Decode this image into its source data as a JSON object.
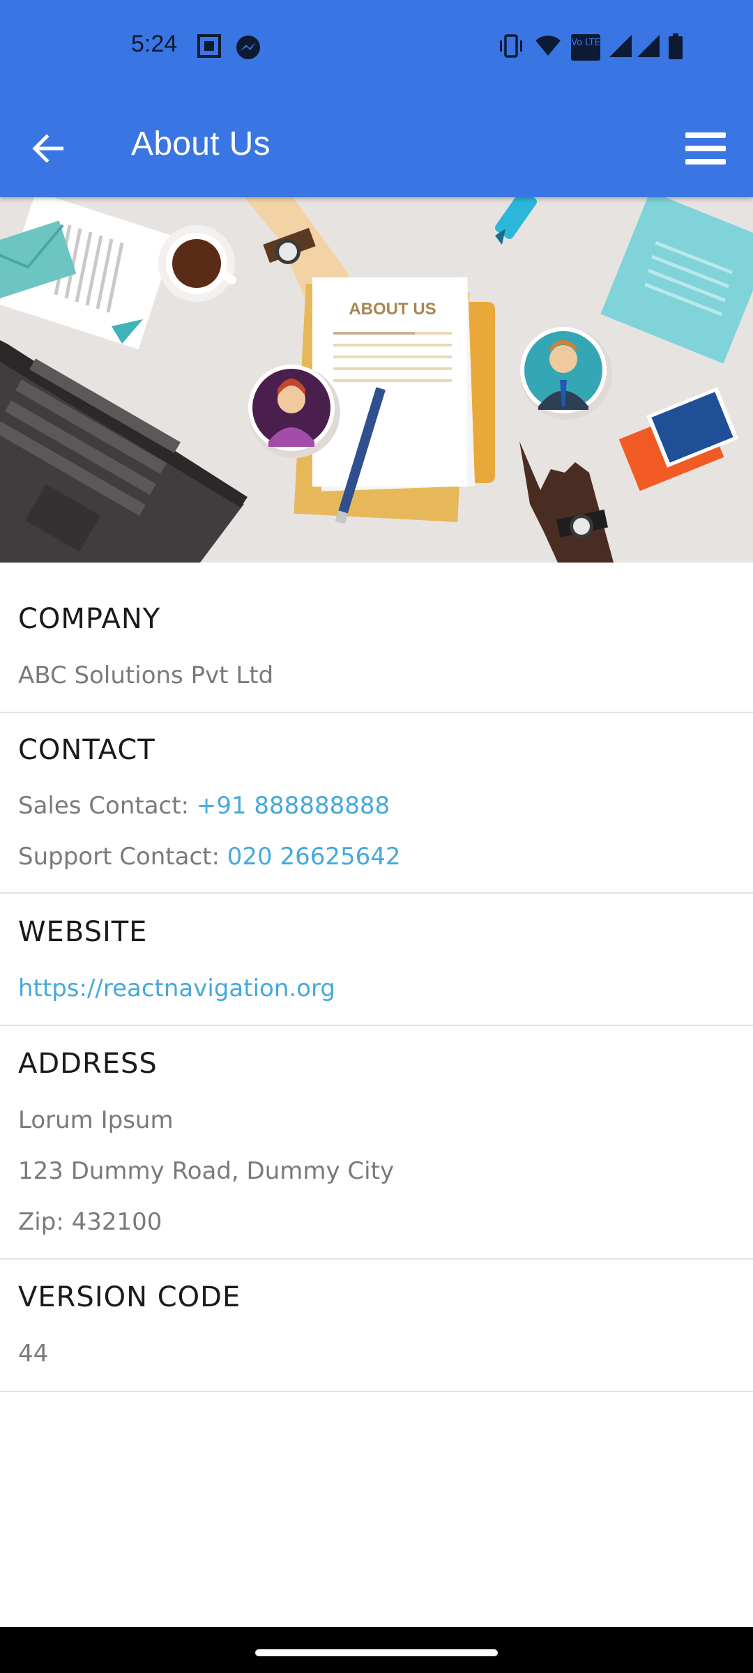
{
  "status_bar": {
    "time": "5:24",
    "volte_label": "Vo LTE",
    "icons": [
      "screenshot-icon",
      "messenger-icon",
      "vibrate-icon",
      "wifi-icon",
      "volte-icon",
      "signal-icon",
      "signal-icon",
      "battery-icon"
    ]
  },
  "app_bar": {
    "title": "About Us",
    "back_icon": "arrow-left-icon",
    "menu_icon": "hamburger-menu-icon",
    "accent_color": "#3a76e3"
  },
  "hero": {
    "document_label": "ABOUT US"
  },
  "sections": {
    "company": {
      "title": "COMPANY",
      "value": "ABC Solutions Pvt Ltd"
    },
    "contact": {
      "title": "CONTACT",
      "sales_label": "Sales Contact: ",
      "sales_value": "+91 888888888",
      "support_label": "Support Contact: ",
      "support_value": "020 26625642"
    },
    "website": {
      "title": "WEBSITE",
      "url": "https://reactnavigation.org"
    },
    "address": {
      "title": "ADDRESS",
      "line1": "Lorum Ipsum",
      "line2": "123 Dummy Road, Dummy City",
      "line3": "Zip: 432100"
    },
    "version": {
      "title": "VERSION CODE",
      "value": "44"
    }
  },
  "link_color": "#45a9dc"
}
